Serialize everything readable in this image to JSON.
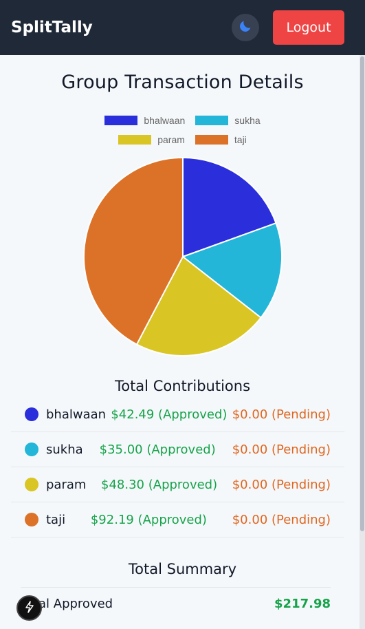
{
  "navbar": {
    "brand": "SplitTally",
    "logout_label": "Logout",
    "theme_icon": "moon-icon"
  },
  "page": {
    "title": "Group Transaction Details"
  },
  "chart_data": {
    "type": "pie",
    "labels": [
      "bhalwaan",
      "sukha",
      "param",
      "taji"
    ],
    "values": [
      42.49,
      35.0,
      48.3,
      92.19
    ],
    "colors": [
      "#2a2edb",
      "#23b6d9",
      "#d9c524",
      "#db7227"
    ],
    "legend": "top"
  },
  "contributions": {
    "title": "Total Contributions",
    "rows": [
      {
        "name": "bhalwaan",
        "approved": "$42.49 (Approved)",
        "pending": "$0.00 (Pending)",
        "color": "#2a2edb"
      },
      {
        "name": "sukha",
        "approved": "$35.00 (Approved)",
        "pending": "$0.00 (Pending)",
        "color": "#23b6d9"
      },
      {
        "name": "param",
        "approved": "$48.30 (Approved)",
        "pending": "$0.00 (Pending)",
        "color": "#d9c524"
      },
      {
        "name": "taji",
        "approved": "$92.19 (Approved)",
        "pending": "$0.00 (Pending)",
        "color": "#db7227"
      }
    ]
  },
  "summary": {
    "title": "Total Summary",
    "approved_label": "Total Approved",
    "approved_value": "$217.98"
  },
  "fab": {
    "icon": "lightning-icon"
  }
}
